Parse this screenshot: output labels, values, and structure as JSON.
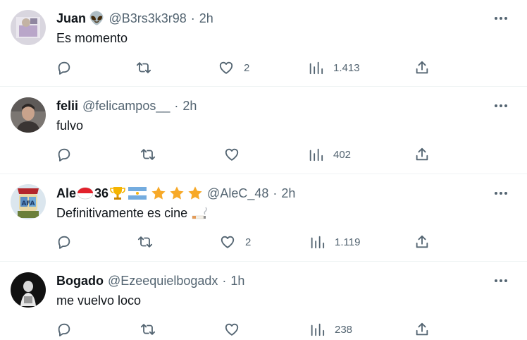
{
  "tweets": [
    {
      "name": "Juan",
      "name_emoji": "👽",
      "handle": "@B3rs3k3r98",
      "separator": "·",
      "time": "2h",
      "text": "Es momento",
      "text_emoji": "",
      "likes": "2",
      "views": "1.413"
    },
    {
      "name": "felii",
      "name_emoji": "",
      "handle": "@felicampos__",
      "separator": "·",
      "time": "2h",
      "text": "fulvo",
      "text_emoji": "",
      "likes": "",
      "views": "402"
    },
    {
      "name": "Ale",
      "name_suffix": "36",
      "name_badges": [
        "indonesia-flag",
        "trophy",
        "argentina-flag",
        "star",
        "star",
        "star"
      ],
      "handle": "@AleC_48",
      "separator": "·",
      "time": "2h",
      "text": "Definitivamente es cine",
      "text_emoji": "cigarette",
      "likes": "2",
      "views": "1.119"
    },
    {
      "name": "Bogado",
      "name_emoji": "",
      "handle": "@Ezeequielbogadx",
      "separator": "·",
      "time": "1h",
      "text": "me vuelvo loco",
      "text_emoji": "",
      "likes": "",
      "views": "238"
    }
  ],
  "icons": [
    "more-icon",
    "reply-icon",
    "retweet-icon",
    "like-icon",
    "views-icon",
    "share-icon"
  ],
  "colors": {
    "text": "#0f1419",
    "secondary": "#536471",
    "divider": "#eff3f4"
  }
}
